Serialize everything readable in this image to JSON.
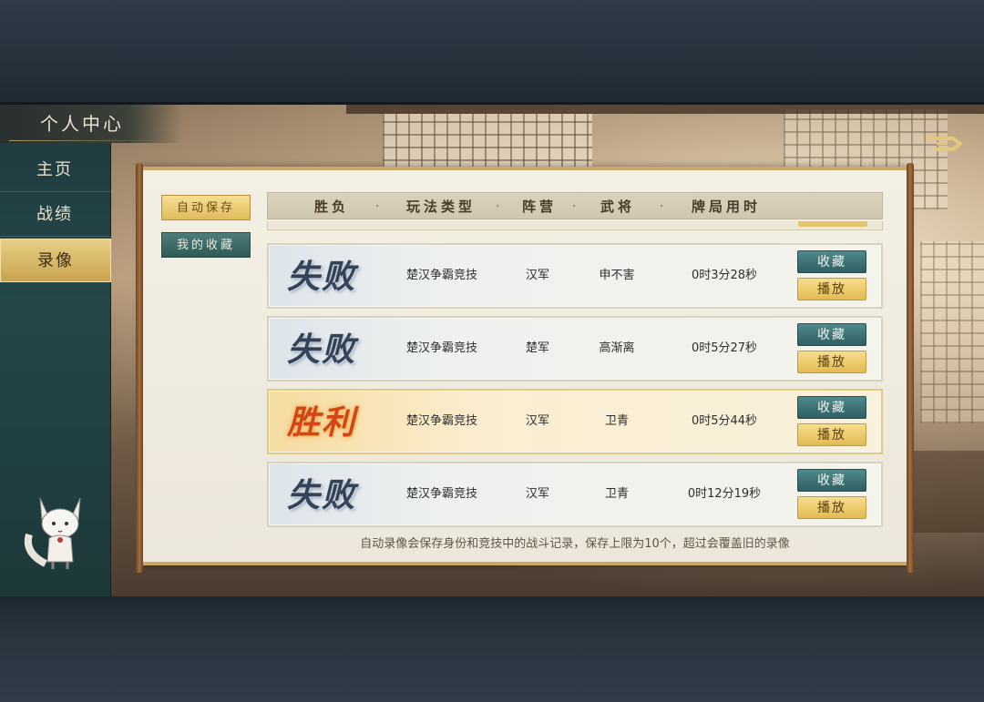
{
  "sidebar": {
    "title": "个人中心",
    "items": [
      {
        "label": "主页"
      },
      {
        "label": "战绩"
      },
      {
        "label": "录像"
      }
    ]
  },
  "tabs": {
    "auto_save": "自动保存",
    "my_favorites": "我的收藏"
  },
  "table": {
    "headers": [
      "胜负",
      "玩法类型",
      "阵营",
      "武将",
      "牌局用时"
    ],
    "separator": "·",
    "rows": [
      {
        "result": "失败",
        "mode": "楚汉争霸竞技",
        "camp": "汉军",
        "general": "申不害",
        "duration": "0时3分28秒",
        "fav": "收藏",
        "play": "播放"
      },
      {
        "result": "失败",
        "mode": "楚汉争霸竞技",
        "camp": "楚军",
        "general": "高渐离",
        "duration": "0时5分27秒",
        "fav": "收藏",
        "play": "播放"
      },
      {
        "result": "胜利",
        "mode": "楚汉争霸竞技",
        "camp": "汉军",
        "general": "卫青",
        "duration": "0时5分44秒",
        "fav": "收藏",
        "play": "播放"
      },
      {
        "result": "失败",
        "mode": "楚汉争霸竞技",
        "camp": "汉军",
        "general": "卫青",
        "duration": "0时12分19秒",
        "fav": "收藏",
        "play": "播放"
      }
    ]
  },
  "footer_note": "自动录像会保存身份和竞技中的战斗记录，保存上限为10个，超过会覆盖旧的录像",
  "icons": {
    "back": "back-arrow-icon",
    "mascot": "fox-mascot-icon"
  },
  "colors": {
    "win": "#d2451c",
    "loss": "#34435a",
    "gold": "#e2bb52",
    "teal": "#2e5f63"
  }
}
